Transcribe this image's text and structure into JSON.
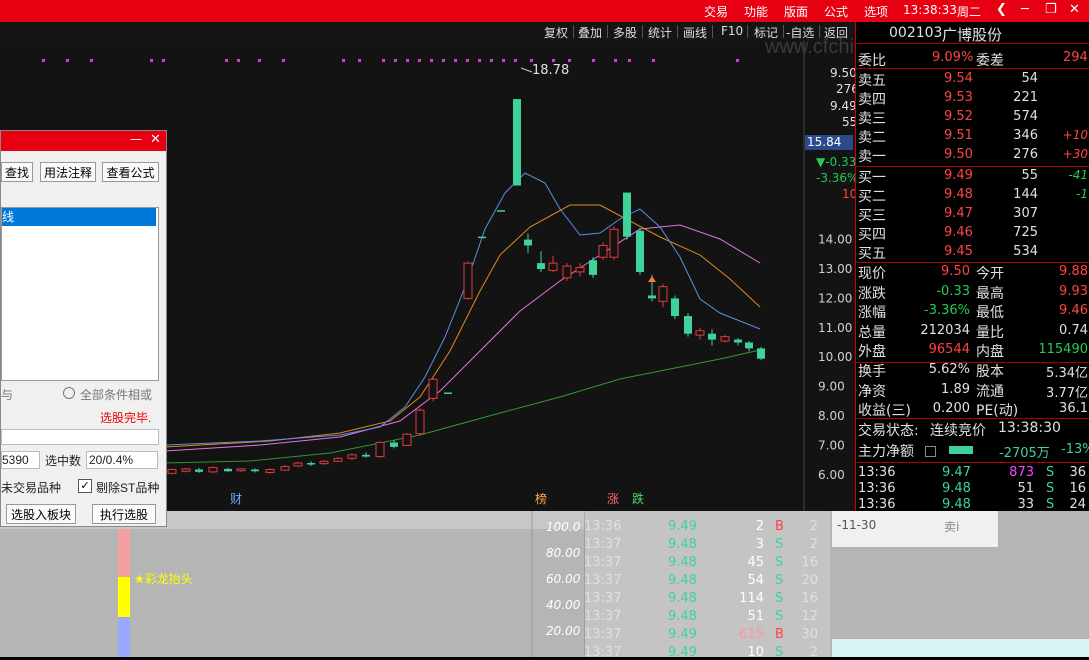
{
  "menu": {
    "items": [
      "交易",
      "功能",
      "版面",
      "公式",
      "选项"
    ],
    "time": "13:38:33",
    "weekday": "周二"
  },
  "toolbar": {
    "items": [
      "复权",
      "叠加",
      "多股",
      "统计",
      "画线",
      "F10",
      "标记",
      "-自选",
      "返回"
    ]
  },
  "watermark": "www.cfchi.com",
  "chart": {
    "high_label": "18.78",
    "markers": [
      "财",
      "榜",
      "涨",
      "跌"
    ],
    "left_price_labels": [
      {
        "text": "9.50",
        "color": "#e0e0e0"
      },
      {
        "text": "276",
        "color": "#e0e0e0"
      },
      {
        "text": "9.49",
        "color": "#e0e0e0"
      },
      {
        "text": "55",
        "color": "#e0e0e0"
      }
    ],
    "price_badge": "15.84",
    "change_value": "▼-0.33",
    "change_pct": "-3.36%",
    "sub_value": "10",
    "y_axis_labels": [
      "14.00",
      "13.00",
      "12.00",
      "11.00",
      "10.00",
      "9.00",
      "8.00",
      "7.00",
      "6.00"
    ]
  },
  "stock": {
    "code": "002103",
    "name": "广博股份"
  },
  "order_book": {
    "weibi_label": "委比",
    "weibi_value": "9.09%",
    "weicha_label": "委差",
    "weicha_value": "294",
    "asks": [
      {
        "label": "卖五",
        "price": "9.54",
        "vol": "54",
        "extra": ""
      },
      {
        "label": "卖四",
        "price": "9.53",
        "vol": "221",
        "extra": ""
      },
      {
        "label": "卖三",
        "price": "9.52",
        "vol": "574",
        "extra": ""
      },
      {
        "label": "卖二",
        "price": "9.51",
        "vol": "346",
        "extra": "+10"
      },
      {
        "label": "卖一",
        "price": "9.50",
        "vol": "276",
        "extra": "+30"
      }
    ],
    "bids": [
      {
        "label": "买一",
        "price": "9.49",
        "vol": "55",
        "extra": "-41"
      },
      {
        "label": "买二",
        "price": "9.48",
        "vol": "144",
        "extra": "-1"
      },
      {
        "label": "买三",
        "price": "9.47",
        "vol": "307",
        "extra": ""
      },
      {
        "label": "买四",
        "price": "9.46",
        "vol": "725",
        "extra": ""
      },
      {
        "label": "买五",
        "price": "9.45",
        "vol": "534",
        "extra": ""
      }
    ]
  },
  "quote": [
    {
      "l1": "现价",
      "v1": "9.50",
      "c1": "#ff4444",
      "l2": "今开",
      "v2": "9.88",
      "c2": "#ff4444"
    },
    {
      "l1": "涨跌",
      "v1": "-0.33",
      "c1": "#22cc55",
      "l2": "最高",
      "v2": "9.93",
      "c2": "#ff4444"
    },
    {
      "l1": "涨幅",
      "v1": "-3.36%",
      "c1": "#22cc55",
      "l2": "最低",
      "v2": "9.46",
      "c2": "#ff4444"
    },
    {
      "l1": "总量",
      "v1": "212034",
      "c1": "#e0e0e0",
      "l2": "量比",
      "v2": "0.74",
      "c2": "#e0e0e0"
    },
    {
      "l1": "外盘",
      "v1": "96544",
      "c1": "#ff4444",
      "l2": "内盘",
      "v2": "115490",
      "c2": "#22cc55"
    }
  ],
  "fundamentals": [
    {
      "l1": "换手",
      "v1": "5.62%",
      "l2": "股本",
      "v2": "5.34亿"
    },
    {
      "l1": "净资",
      "v1": "1.89",
      "l2": "流通",
      "v2": "3.77亿"
    },
    {
      "l1": "收益(三)",
      "v1": "0.200",
      "l2": "PE(动)",
      "v2": "36.1"
    }
  ],
  "status": {
    "label": "交易状态:",
    "value": "连续竞价",
    "time": "13:38:30",
    "flow_label": "主力净额",
    "flow_value": "-2705万",
    "flow_pct": "-13%"
  },
  "ticks_top": [
    {
      "time": "13:36",
      "price": "9.47",
      "vol": "873",
      "bs": "S",
      "n": "36",
      "volColor": "#ff44ff"
    },
    {
      "time": "13:36",
      "price": "9.48",
      "vol": "51",
      "bs": "S",
      "n": "16",
      "volColor": "#e0e0e0"
    },
    {
      "time": "13:36",
      "price": "9.48",
      "vol": "33",
      "bs": "S",
      "n": "24",
      "volColor": "#e0e0e0"
    }
  ],
  "ticks_bottom": [
    {
      "time": "13:36",
      "price": "9.49",
      "vol": "2",
      "bs": "B",
      "n": "2",
      "volColor": "#ffffff"
    },
    {
      "time": "13:37",
      "price": "9.48",
      "vol": "3",
      "bs": "S",
      "n": "2",
      "volColor": "#ffffff"
    },
    {
      "time": "13:37",
      "price": "9.48",
      "vol": "45",
      "bs": "S",
      "n": "16",
      "volColor": "#ffffff"
    },
    {
      "time": "13:37",
      "price": "9.48",
      "vol": "54",
      "bs": "S",
      "n": "20",
      "volColor": "#ffffff"
    },
    {
      "time": "13:37",
      "price": "9.48",
      "vol": "114",
      "bs": "S",
      "n": "16",
      "volColor": "#ffffff"
    },
    {
      "time": "13:37",
      "price": "9.48",
      "vol": "51",
      "bs": "S",
      "n": "12",
      "volColor": "#ffffff"
    },
    {
      "time": "13:37",
      "price": "9.49",
      "vol": "615",
      "bs": "B",
      "n": "30",
      "volColor": "#ff9999"
    },
    {
      "time": "13:37",
      "price": "9.49",
      "vol": "10",
      "bs": "S",
      "n": "2",
      "volColor": "#ffffff"
    }
  ],
  "bottom": {
    "indicator_label": "★彩龙抬头",
    "scale_labels": [
      "100.0",
      "80.00",
      "60.00",
      "40.00",
      "20.00"
    ],
    "date_label": "-11-30",
    "partial_label": "卖i"
  },
  "dialog": {
    "buttons": [
      "查找",
      "用法注释",
      "查看公式"
    ],
    "selected_item": "线",
    "radio_left": "与",
    "radio_right": "全部条件相或",
    "status_text": "选股完毕.",
    "count_value": "5390",
    "selected_count_label": "选中数",
    "selected_count_value": "20/0.4%",
    "chk1": "未交易品种",
    "chk2": "剔除ST品种",
    "btn_add": "选股入板块",
    "btn_exec": "执行选股"
  }
}
